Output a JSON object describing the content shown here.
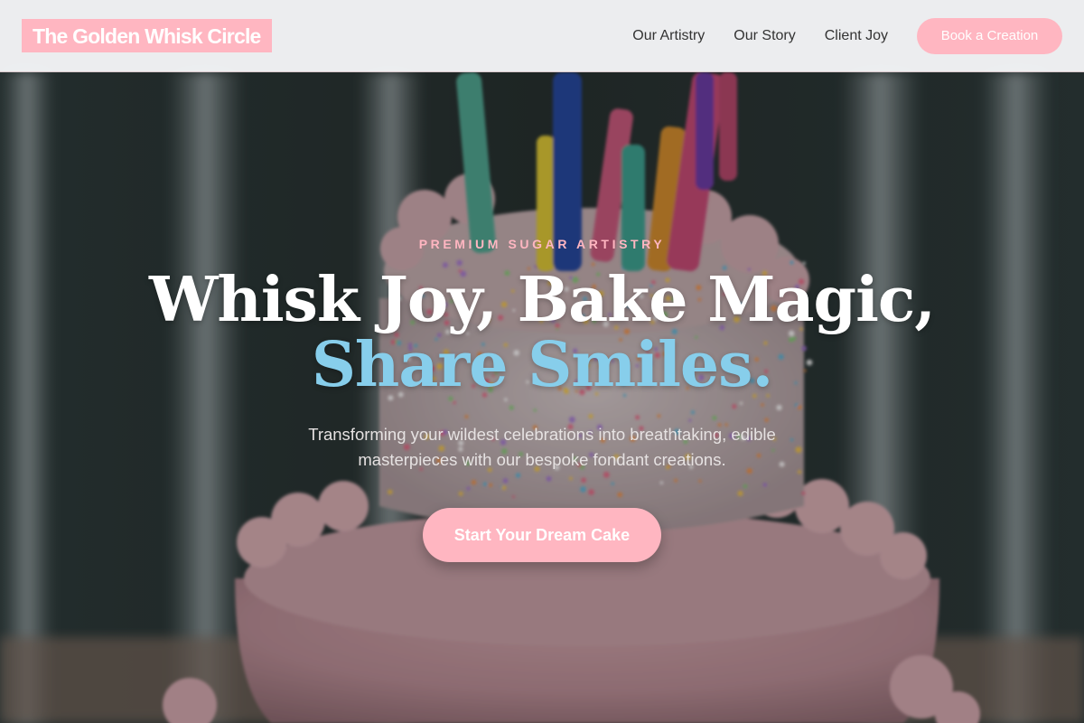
{
  "brand": {
    "name": "The Golden Whisk Circle"
  },
  "nav": {
    "links": [
      {
        "label": "Our Artistry"
      },
      {
        "label": "Our Story"
      },
      {
        "label": "Client Joy"
      }
    ],
    "cta_label": "Book a Creation"
  },
  "hero": {
    "eyebrow": "PREMIUM SUGAR ARTISTRY",
    "headline_line1": "Whisk Joy, Bake Magic,",
    "headline_line2": "Share Smiles.",
    "subtitle": "Transforming your wildest celebrations into breathtaking, edible masterpieces with our bespoke fondant creations.",
    "cta_label": "Start Your Dream Cake",
    "background_image": "cake-with-candles-image"
  },
  "colors": {
    "accent_pink": "#ffb6c1",
    "accent_blue": "#87ceeb",
    "nav_text": "#333333",
    "headline_white": "#ffffff"
  }
}
